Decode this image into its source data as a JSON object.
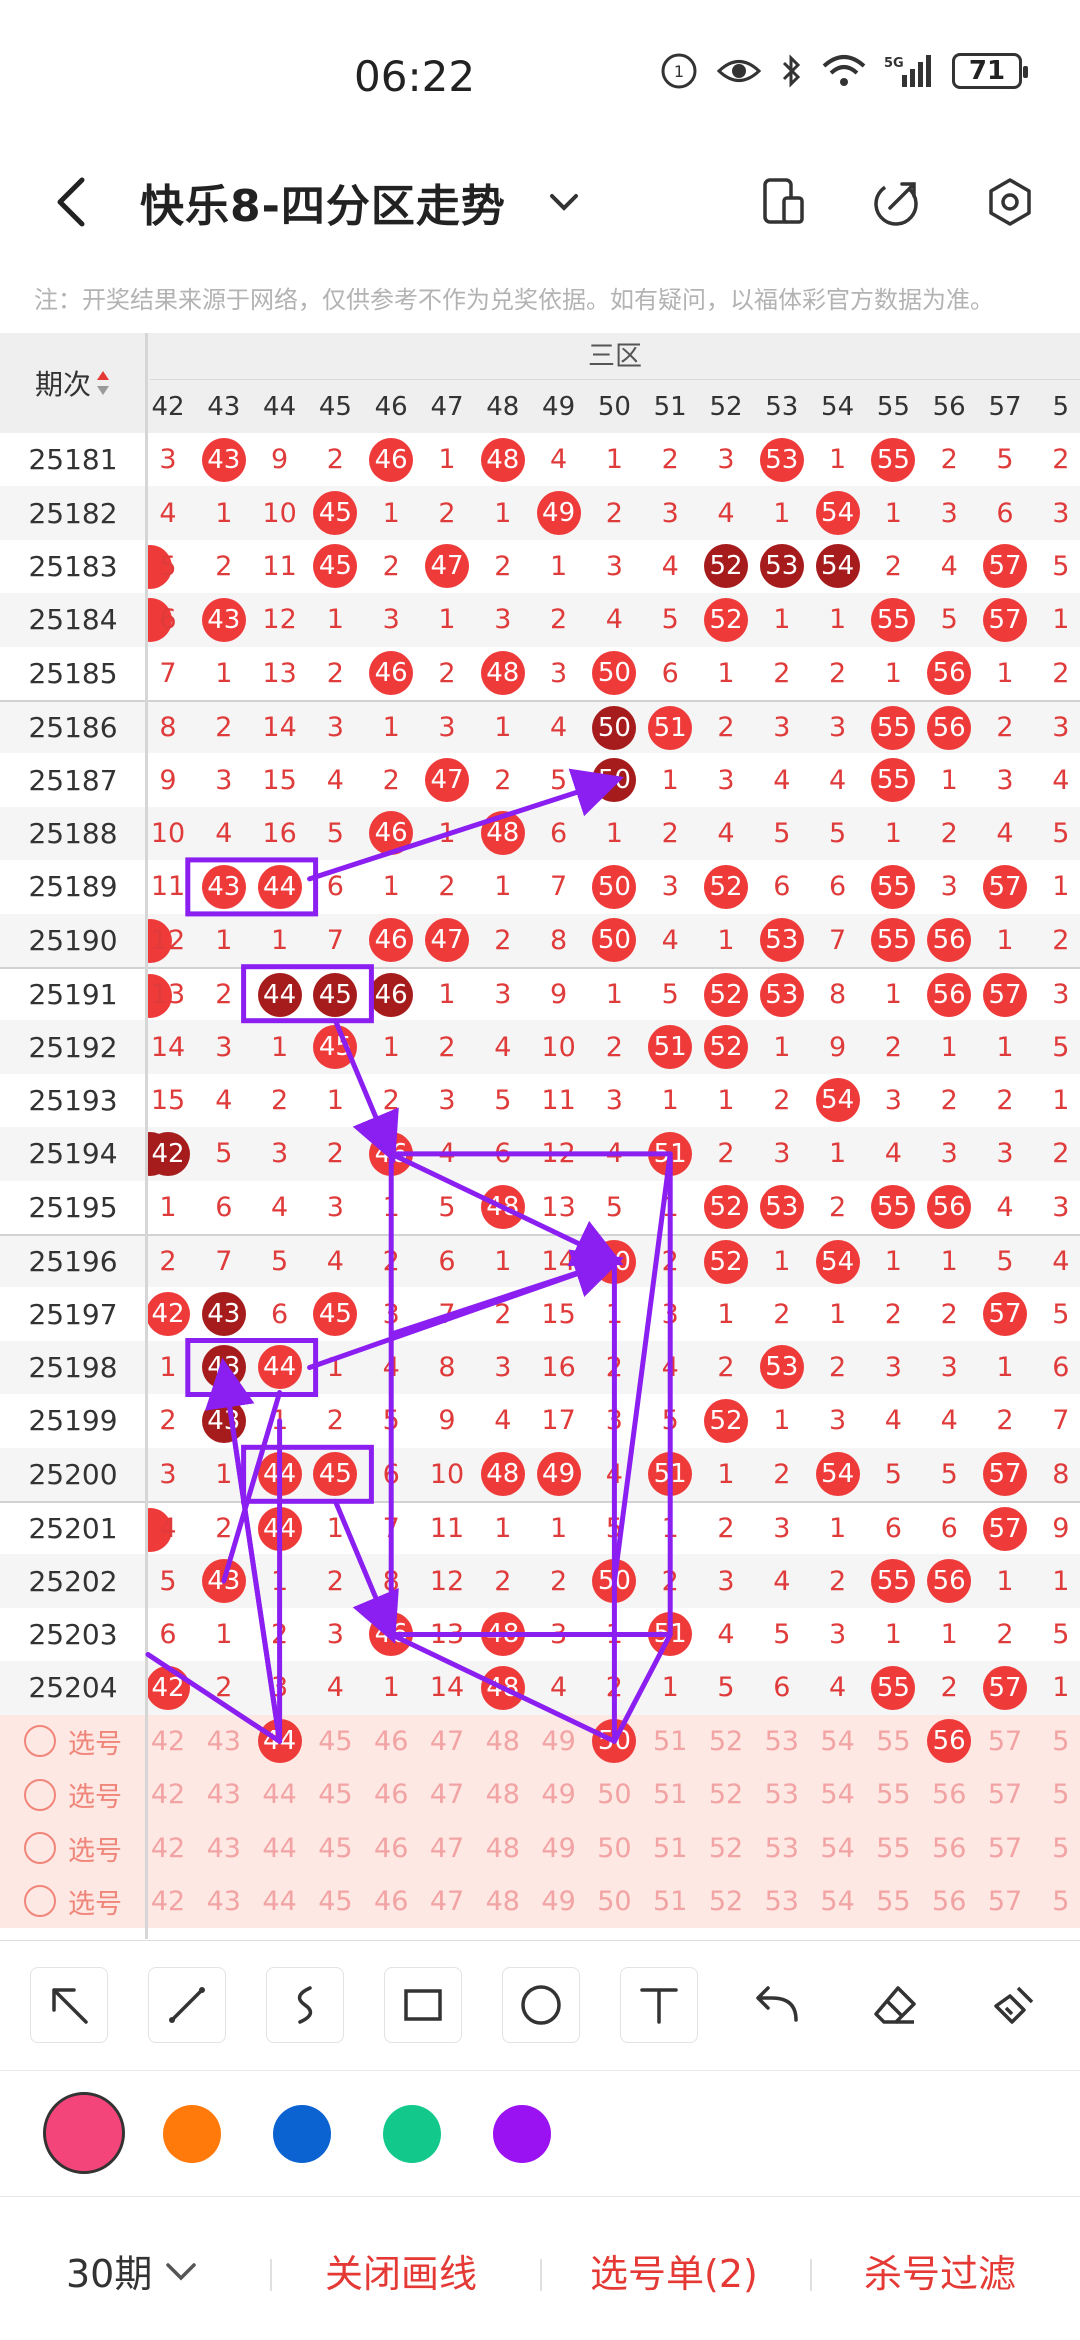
{
  "status_bar": {
    "time": "06:22",
    "battery": "71",
    "network": "5G"
  },
  "header": {
    "title": "快乐8-四分区走势"
  },
  "notice": "注：开奖结果来源于网络，仅供参考不作为兑奖依据。如有疑问，以福体彩官方数据为准。",
  "table": {
    "period_header": "期次",
    "zone_label": "三区",
    "columns": [
      "42",
      "43",
      "44",
      "45",
      "46",
      "47",
      "48",
      "49",
      "50",
      "51",
      "52",
      "53",
      "54",
      "55",
      "56",
      "57",
      "5"
    ],
    "rows": [
      {
        "period": "25181",
        "cells": [
          "3",
          "43",
          "9",
          "2",
          "46",
          "1",
          "48",
          "4",
          "1",
          "2",
          "3",
          "53",
          "1",
          "55",
          "2",
          "5",
          "2"
        ],
        "left_ball": ""
      },
      {
        "period": "25182",
        "cells": [
          "4",
          "1",
          "10",
          "45",
          "1",
          "2",
          "1",
          "49",
          "2",
          "3",
          "4",
          "1",
          "54",
          "1",
          "3",
          "6",
          "3"
        ],
        "left_ball": ""
      },
      {
        "period": "25183",
        "cells": [
          "5",
          "2",
          "11",
          "45",
          "2",
          "47",
          "2",
          "1",
          "3",
          "4",
          "52",
          "53",
          "54",
          "2",
          "4",
          "57",
          "5"
        ],
        "left_ball": "light"
      },
      {
        "period": "25184",
        "cells": [
          "6",
          "43",
          "12",
          "1",
          "3",
          "1",
          "3",
          "2",
          "4",
          "5",
          "52",
          "1",
          "1",
          "55",
          "5",
          "57",
          "1"
        ],
        "left_ball": "light"
      },
      {
        "period": "25185",
        "cells": [
          "7",
          "1",
          "13",
          "2",
          "46",
          "2",
          "48",
          "3",
          "50",
          "6",
          "1",
          "2",
          "2",
          "1",
          "56",
          "1",
          "2"
        ],
        "left_ball": ""
      },
      {
        "period": "25186",
        "cells": [
          "8",
          "2",
          "14",
          "3",
          "1",
          "3",
          "1",
          "4",
          "50",
          "51",
          "2",
          "3",
          "3",
          "55",
          "56",
          "2",
          "3"
        ],
        "left_ball": ""
      },
      {
        "period": "25187",
        "cells": [
          "9",
          "3",
          "15",
          "4",
          "2",
          "47",
          "2",
          "5",
          "50",
          "1",
          "3",
          "4",
          "4",
          "55",
          "1",
          "3",
          "4"
        ],
        "left_ball": ""
      },
      {
        "period": "25188",
        "cells": [
          "10",
          "4",
          "16",
          "5",
          "46",
          "1",
          "48",
          "6",
          "1",
          "2",
          "4",
          "5",
          "5",
          "1",
          "2",
          "4",
          "5"
        ],
        "left_ball": ""
      },
      {
        "period": "25189",
        "cells": [
          "11",
          "43",
          "44",
          "6",
          "1",
          "2",
          "1",
          "7",
          "50",
          "3",
          "52",
          "6",
          "6",
          "55",
          "3",
          "57",
          "1"
        ],
        "left_ball": ""
      },
      {
        "period": "25190",
        "cells": [
          "12",
          "1",
          "1",
          "7",
          "46",
          "47",
          "2",
          "8",
          "50",
          "4",
          "1",
          "53",
          "7",
          "55",
          "56",
          "1",
          "2"
        ],
        "left_ball": "light"
      },
      {
        "period": "25191",
        "cells": [
          "13",
          "2",
          "44",
          "45",
          "46",
          "1",
          "3",
          "9",
          "1",
          "5",
          "52",
          "53",
          "8",
          "1",
          "56",
          "57",
          "3"
        ],
        "left_ball": "light"
      },
      {
        "period": "25192",
        "cells": [
          "14",
          "3",
          "1",
          "45",
          "1",
          "2",
          "4",
          "10",
          "2",
          "51",
          "52",
          "1",
          "9",
          "2",
          "1",
          "1",
          "5"
        ],
        "left_ball": ""
      },
      {
        "period": "25193",
        "cells": [
          "15",
          "4",
          "2",
          "1",
          "2",
          "3",
          "5",
          "11",
          "3",
          "1",
          "1",
          "2",
          "54",
          "3",
          "2",
          "2",
          "1"
        ],
        "left_ball": ""
      },
      {
        "period": "25194",
        "cells": [
          "42",
          "5",
          "3",
          "2",
          "46",
          "4",
          "6",
          "12",
          "4",
          "51",
          "2",
          "3",
          "1",
          "4",
          "3",
          "3",
          "2"
        ],
        "left_ball": "dark"
      },
      {
        "period": "25195",
        "cells": [
          "1",
          "6",
          "4",
          "3",
          "1",
          "5",
          "48",
          "13",
          "5",
          "1",
          "52",
          "53",
          "2",
          "55",
          "56",
          "4",
          "3"
        ],
        "left_ball": ""
      },
      {
        "period": "25196",
        "cells": [
          "2",
          "7",
          "5",
          "4",
          "2",
          "6",
          "1",
          "14",
          "50",
          "2",
          "52",
          "1",
          "54",
          "1",
          "1",
          "5",
          "4"
        ],
        "left_ball": ""
      },
      {
        "period": "25197",
        "cells": [
          "42",
          "43",
          "6",
          "45",
          "3",
          "7",
          "2",
          "15",
          "1",
          "3",
          "1",
          "2",
          "1",
          "2",
          "2",
          "57",
          "5"
        ],
        "left_ball": ""
      },
      {
        "period": "25198",
        "cells": [
          "1",
          "43",
          "44",
          "1",
          "4",
          "8",
          "3",
          "16",
          "2",
          "4",
          "2",
          "53",
          "2",
          "3",
          "3",
          "1",
          "6"
        ],
        "left_ball": ""
      },
      {
        "period": "25199",
        "cells": [
          "2",
          "43",
          "1",
          "2",
          "5",
          "9",
          "4",
          "17",
          "3",
          "5",
          "52",
          "1",
          "3",
          "4",
          "4",
          "2",
          "7"
        ],
        "left_ball": ""
      },
      {
        "period": "25200",
        "cells": [
          "3",
          "1",
          "44",
          "45",
          "6",
          "10",
          "48",
          "49",
          "4",
          "51",
          "1",
          "2",
          "54",
          "5",
          "5",
          "57",
          "8"
        ],
        "left_ball": ""
      },
      {
        "period": "25201",
        "cells": [
          "4",
          "2",
          "44",
          "1",
          "7",
          "11",
          "1",
          "1",
          "5",
          "1",
          "2",
          "3",
          "1",
          "6",
          "6",
          "57",
          "9"
        ],
        "left_ball": "light"
      },
      {
        "period": "25202",
        "cells": [
          "5",
          "43",
          "1",
          "2",
          "8",
          "12",
          "2",
          "2",
          "50",
          "2",
          "3",
          "4",
          "2",
          "55",
          "56",
          "1",
          "1"
        ],
        "left_ball": ""
      },
      {
        "period": "25203",
        "cells": [
          "6",
          "1",
          "2",
          "3",
          "46",
          "13",
          "48",
          "3",
          "1",
          "51",
          "4",
          "5",
          "3",
          "1",
          "1",
          "2",
          "5"
        ],
        "left_ball": ""
      },
      {
        "period": "25204",
        "cells": [
          "42",
          "2",
          "3",
          "4",
          "1",
          "14",
          "48",
          "4",
          "2",
          "1",
          "5",
          "6",
          "4",
          "55",
          "2",
          "57",
          "1"
        ],
        "left_ball": ""
      }
    ],
    "select_rows": [
      {
        "label": "选号",
        "picked": [
          "44",
          "50",
          "56"
        ]
      },
      {
        "label": "选号",
        "picked": []
      },
      {
        "label": "选号",
        "picked": []
      },
      {
        "label": "选号",
        "picked": []
      }
    ]
  },
  "tools": [
    "arrow",
    "line",
    "curve",
    "rectangle",
    "circle",
    "text",
    "undo",
    "eraser",
    "clear"
  ],
  "colors": [
    "#f4457a",
    "#ff7a0a",
    "#0b63d1",
    "#12c98b",
    "#9b12f2"
  ],
  "bottom": {
    "period_select": "30期",
    "close_draw": "关闭画线",
    "pick_list": "选号单(2)",
    "filter": "杀号过滤"
  }
}
